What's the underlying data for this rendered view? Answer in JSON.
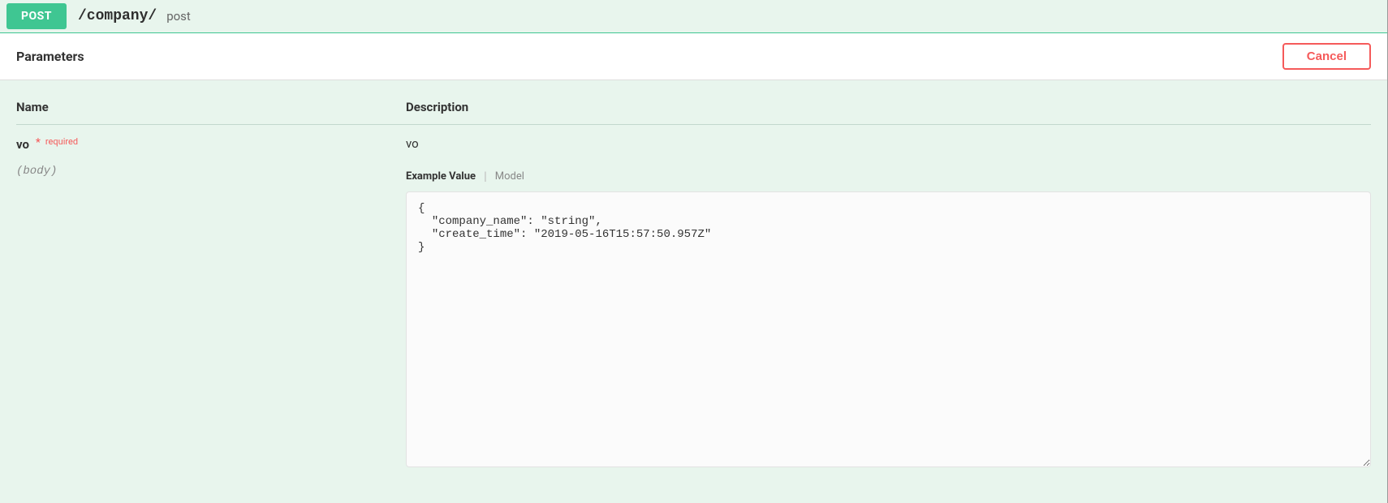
{
  "header": {
    "method": "POST",
    "path": "/company/",
    "summary": "post"
  },
  "parameters": {
    "title": "Parameters",
    "cancel_label": "Cancel",
    "columns": {
      "name": "Name",
      "description": "Description"
    },
    "rows": [
      {
        "name": "vo",
        "required_star": "*",
        "required_text": "required",
        "in": "(body)",
        "description": "vo",
        "tabs": {
          "example": "Example Value",
          "model": "Model"
        },
        "body": "{\n  \"company_name\": \"string\",\n  \"create_time\": \"2019-05-16T15:57:50.957Z\"\n}"
      }
    ]
  }
}
